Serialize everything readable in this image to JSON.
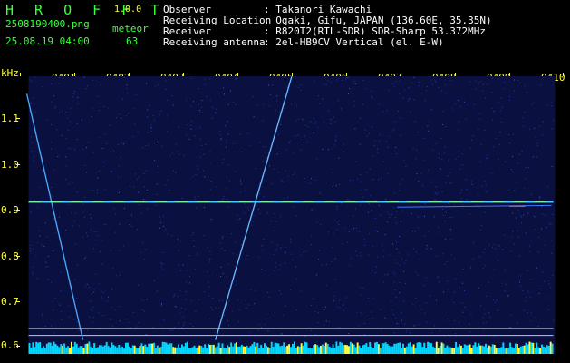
{
  "header": {
    "brand": "H R O F F T",
    "version": "1.0.0",
    "filename": "2508190400.png",
    "datetime": "25.08.19 04:00",
    "meteor_label": "meteor",
    "meteor_count": "63",
    "info": [
      {
        "label": "Observer",
        "value": ": Takanori Kawachi"
      },
      {
        "label": "Receiving Location",
        "value": ": Ogaki, Gifu, JAPAN (136.60E, 35.35N)"
      },
      {
        "label": "Receiver",
        "value": ": R820T2(RTL-SDR) SDR-Sharp 53.372MHz"
      },
      {
        "label": "Receiving antenna",
        "value": ": 2el-HB9CV Vertical (el. E-W)"
      }
    ]
  },
  "chart_data": {
    "type": "heatmap",
    "ylabel": "kHz",
    "x_ticks": [
      "0401",
      "0402",
      "0403",
      "0404",
      "0405",
      "0406",
      "0407",
      "0408",
      "0409",
      "0410"
    ],
    "y_ticks": [
      "1.1",
      "1.0",
      "0.9",
      "0.8",
      "0.7",
      "0.6"
    ],
    "ylim": [
      0.58,
      1.18
    ],
    "carrier_khz": 0.906,
    "colors": {
      "background": "#0a1040",
      "noise": "#2a3aa0",
      "carrier": "#4ac8ff",
      "ticks": "#ffff3c",
      "bottom_bar": "#00d8ff"
    }
  }
}
